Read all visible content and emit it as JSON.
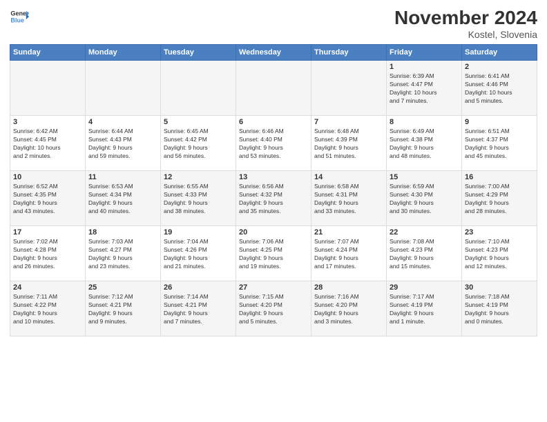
{
  "header": {
    "logo_general": "General",
    "logo_blue": "Blue",
    "title": "November 2024",
    "location": "Kostel, Slovenia"
  },
  "weekdays": [
    "Sunday",
    "Monday",
    "Tuesday",
    "Wednesday",
    "Thursday",
    "Friday",
    "Saturday"
  ],
  "weeks": [
    [
      {
        "day": "",
        "info": ""
      },
      {
        "day": "",
        "info": ""
      },
      {
        "day": "",
        "info": ""
      },
      {
        "day": "",
        "info": ""
      },
      {
        "day": "",
        "info": ""
      },
      {
        "day": "1",
        "info": "Sunrise: 6:39 AM\nSunset: 4:47 PM\nDaylight: 10 hours\nand 7 minutes."
      },
      {
        "day": "2",
        "info": "Sunrise: 6:41 AM\nSunset: 4:46 PM\nDaylight: 10 hours\nand 5 minutes."
      }
    ],
    [
      {
        "day": "3",
        "info": "Sunrise: 6:42 AM\nSunset: 4:45 PM\nDaylight: 10 hours\nand 2 minutes."
      },
      {
        "day": "4",
        "info": "Sunrise: 6:44 AM\nSunset: 4:43 PM\nDaylight: 9 hours\nand 59 minutes."
      },
      {
        "day": "5",
        "info": "Sunrise: 6:45 AM\nSunset: 4:42 PM\nDaylight: 9 hours\nand 56 minutes."
      },
      {
        "day": "6",
        "info": "Sunrise: 6:46 AM\nSunset: 4:40 PM\nDaylight: 9 hours\nand 53 minutes."
      },
      {
        "day": "7",
        "info": "Sunrise: 6:48 AM\nSunset: 4:39 PM\nDaylight: 9 hours\nand 51 minutes."
      },
      {
        "day": "8",
        "info": "Sunrise: 6:49 AM\nSunset: 4:38 PM\nDaylight: 9 hours\nand 48 minutes."
      },
      {
        "day": "9",
        "info": "Sunrise: 6:51 AM\nSunset: 4:37 PM\nDaylight: 9 hours\nand 45 minutes."
      }
    ],
    [
      {
        "day": "10",
        "info": "Sunrise: 6:52 AM\nSunset: 4:35 PM\nDaylight: 9 hours\nand 43 minutes."
      },
      {
        "day": "11",
        "info": "Sunrise: 6:53 AM\nSunset: 4:34 PM\nDaylight: 9 hours\nand 40 minutes."
      },
      {
        "day": "12",
        "info": "Sunrise: 6:55 AM\nSunset: 4:33 PM\nDaylight: 9 hours\nand 38 minutes."
      },
      {
        "day": "13",
        "info": "Sunrise: 6:56 AM\nSunset: 4:32 PM\nDaylight: 9 hours\nand 35 minutes."
      },
      {
        "day": "14",
        "info": "Sunrise: 6:58 AM\nSunset: 4:31 PM\nDaylight: 9 hours\nand 33 minutes."
      },
      {
        "day": "15",
        "info": "Sunrise: 6:59 AM\nSunset: 4:30 PM\nDaylight: 9 hours\nand 30 minutes."
      },
      {
        "day": "16",
        "info": "Sunrise: 7:00 AM\nSunset: 4:29 PM\nDaylight: 9 hours\nand 28 minutes."
      }
    ],
    [
      {
        "day": "17",
        "info": "Sunrise: 7:02 AM\nSunset: 4:28 PM\nDaylight: 9 hours\nand 26 minutes."
      },
      {
        "day": "18",
        "info": "Sunrise: 7:03 AM\nSunset: 4:27 PM\nDaylight: 9 hours\nand 23 minutes."
      },
      {
        "day": "19",
        "info": "Sunrise: 7:04 AM\nSunset: 4:26 PM\nDaylight: 9 hours\nand 21 minutes."
      },
      {
        "day": "20",
        "info": "Sunrise: 7:06 AM\nSunset: 4:25 PM\nDaylight: 9 hours\nand 19 minutes."
      },
      {
        "day": "21",
        "info": "Sunrise: 7:07 AM\nSunset: 4:24 PM\nDaylight: 9 hours\nand 17 minutes."
      },
      {
        "day": "22",
        "info": "Sunrise: 7:08 AM\nSunset: 4:23 PM\nDaylight: 9 hours\nand 15 minutes."
      },
      {
        "day": "23",
        "info": "Sunrise: 7:10 AM\nSunset: 4:23 PM\nDaylight: 9 hours\nand 12 minutes."
      }
    ],
    [
      {
        "day": "24",
        "info": "Sunrise: 7:11 AM\nSunset: 4:22 PM\nDaylight: 9 hours\nand 10 minutes."
      },
      {
        "day": "25",
        "info": "Sunrise: 7:12 AM\nSunset: 4:21 PM\nDaylight: 9 hours\nand 9 minutes."
      },
      {
        "day": "26",
        "info": "Sunrise: 7:14 AM\nSunset: 4:21 PM\nDaylight: 9 hours\nand 7 minutes."
      },
      {
        "day": "27",
        "info": "Sunrise: 7:15 AM\nSunset: 4:20 PM\nDaylight: 9 hours\nand 5 minutes."
      },
      {
        "day": "28",
        "info": "Sunrise: 7:16 AM\nSunset: 4:20 PM\nDaylight: 9 hours\nand 3 minutes."
      },
      {
        "day": "29",
        "info": "Sunrise: 7:17 AM\nSunset: 4:19 PM\nDaylight: 9 hours\nand 1 minute."
      },
      {
        "day": "30",
        "info": "Sunrise: 7:18 AM\nSunset: 4:19 PM\nDaylight: 9 hours\nand 0 minutes."
      }
    ]
  ]
}
